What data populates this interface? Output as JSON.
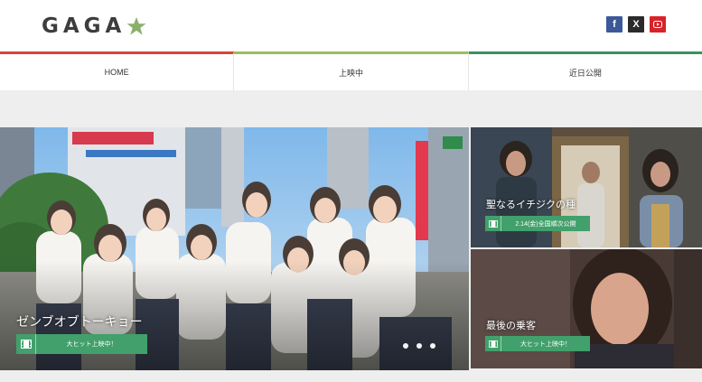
{
  "header": {
    "logo_text": "GAGA",
    "social": {
      "facebook": "f",
      "x": "X",
      "youtube": "youtube-icon"
    }
  },
  "nav": [
    "HOME",
    "上映中",
    "近日公開"
  ],
  "hero": {
    "title": "ゼンブオブトーキョー",
    "badge": "大ヒット上映中！"
  },
  "side": [
    {
      "title": "聖なるイチジクの種",
      "badge": "2.14(金)全国順次公開"
    },
    {
      "title": "最後の乗客",
      "badge": "大ヒット上映中！"
    }
  ],
  "colors": {
    "badge": "#41a06b",
    "nav_red": "#d9453b",
    "nav_lime": "#9dbc5c",
    "nav_green": "#3a9163"
  }
}
